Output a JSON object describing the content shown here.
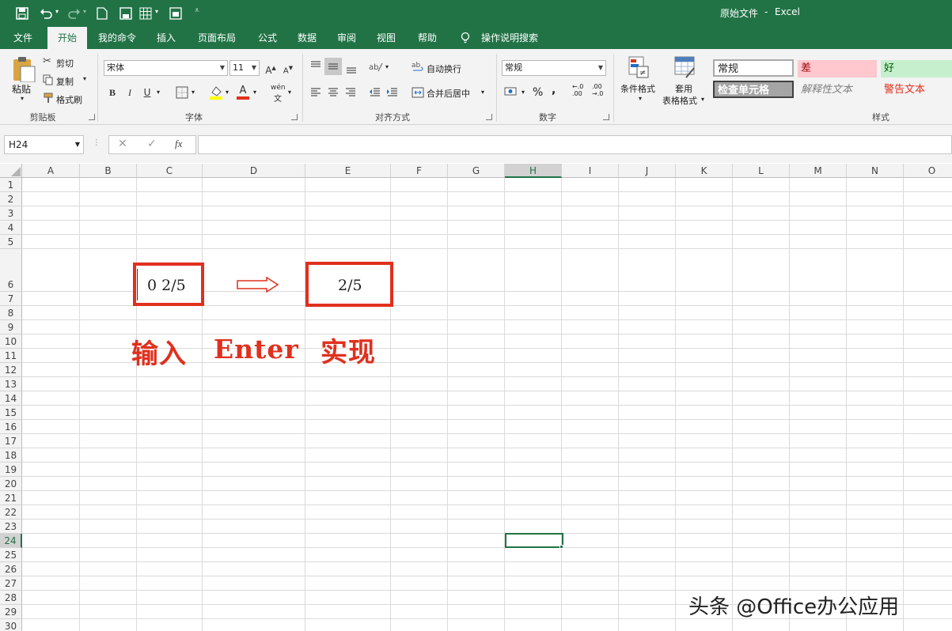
{
  "titlebar": {
    "doc_title": "原始文件",
    "separator": "-",
    "app_name": "Excel"
  },
  "tabs": [
    "文件",
    "开始",
    "我的命令",
    "插入",
    "页面布局",
    "公式",
    "数据",
    "审阅",
    "视图",
    "帮助"
  ],
  "tell_me": "操作说明搜索",
  "ribbon": {
    "clipboard": {
      "paste": "粘贴",
      "cut": "剪切",
      "copy": "复制",
      "format_painter": "格式刷",
      "label": "剪贴板"
    },
    "font": {
      "name": "宋体",
      "size": "11",
      "bold": "B",
      "italic": "I",
      "underline": "U",
      "label": "字体",
      "grow": "A",
      "shrink": "A",
      "wen": "wén",
      "wen2": "文"
    },
    "alignment": {
      "wrap": "自动换行",
      "merge": "合并后居中",
      "label": "对齐方式"
    },
    "number": {
      "format": "常规",
      "percent": "%",
      "comma": ",",
      "inc_dec": "←.0\n.00",
      "dec_dec": ".00\n→.0",
      "label": "数字"
    },
    "styles": {
      "conditional": "条件格式",
      "table1": "套用",
      "table2": "表格格式",
      "normal": "常规",
      "bad": "差",
      "good": "好",
      "check_cell": "检查单元格",
      "explanatory": "解释性文本",
      "warning": "警告文本",
      "label": "样式"
    }
  },
  "formula_bar": {
    "name_box": "H24",
    "cancel": "✕",
    "enter": "✓",
    "fx": "fx",
    "value": ""
  },
  "columns": [
    "A",
    "B",
    "C",
    "D",
    "E",
    "F",
    "G",
    "H",
    "I",
    "J",
    "K",
    "L",
    "M",
    "N",
    "O"
  ],
  "rows": [
    "1",
    "2",
    "3",
    "4",
    "5",
    "6",
    "7",
    "8",
    "9",
    "10",
    "11",
    "12",
    "13",
    "14",
    "15",
    "16",
    "17",
    "18",
    "19",
    "20",
    "21",
    "22",
    "23",
    "24",
    "25",
    "26",
    "27",
    "28",
    "29",
    "30"
  ],
  "content": {
    "input_value": "0 2/5",
    "result_value": "2/5",
    "caption_input": "输入",
    "caption_enter": "Enter",
    "caption_result": "实现"
  },
  "watermark": "头条 @Office办公应用",
  "colors": {
    "accent": "#217346",
    "highlight_red": "#e0301e",
    "bad_fill": "#ffc7ce",
    "good_fill": "#c6efce"
  }
}
